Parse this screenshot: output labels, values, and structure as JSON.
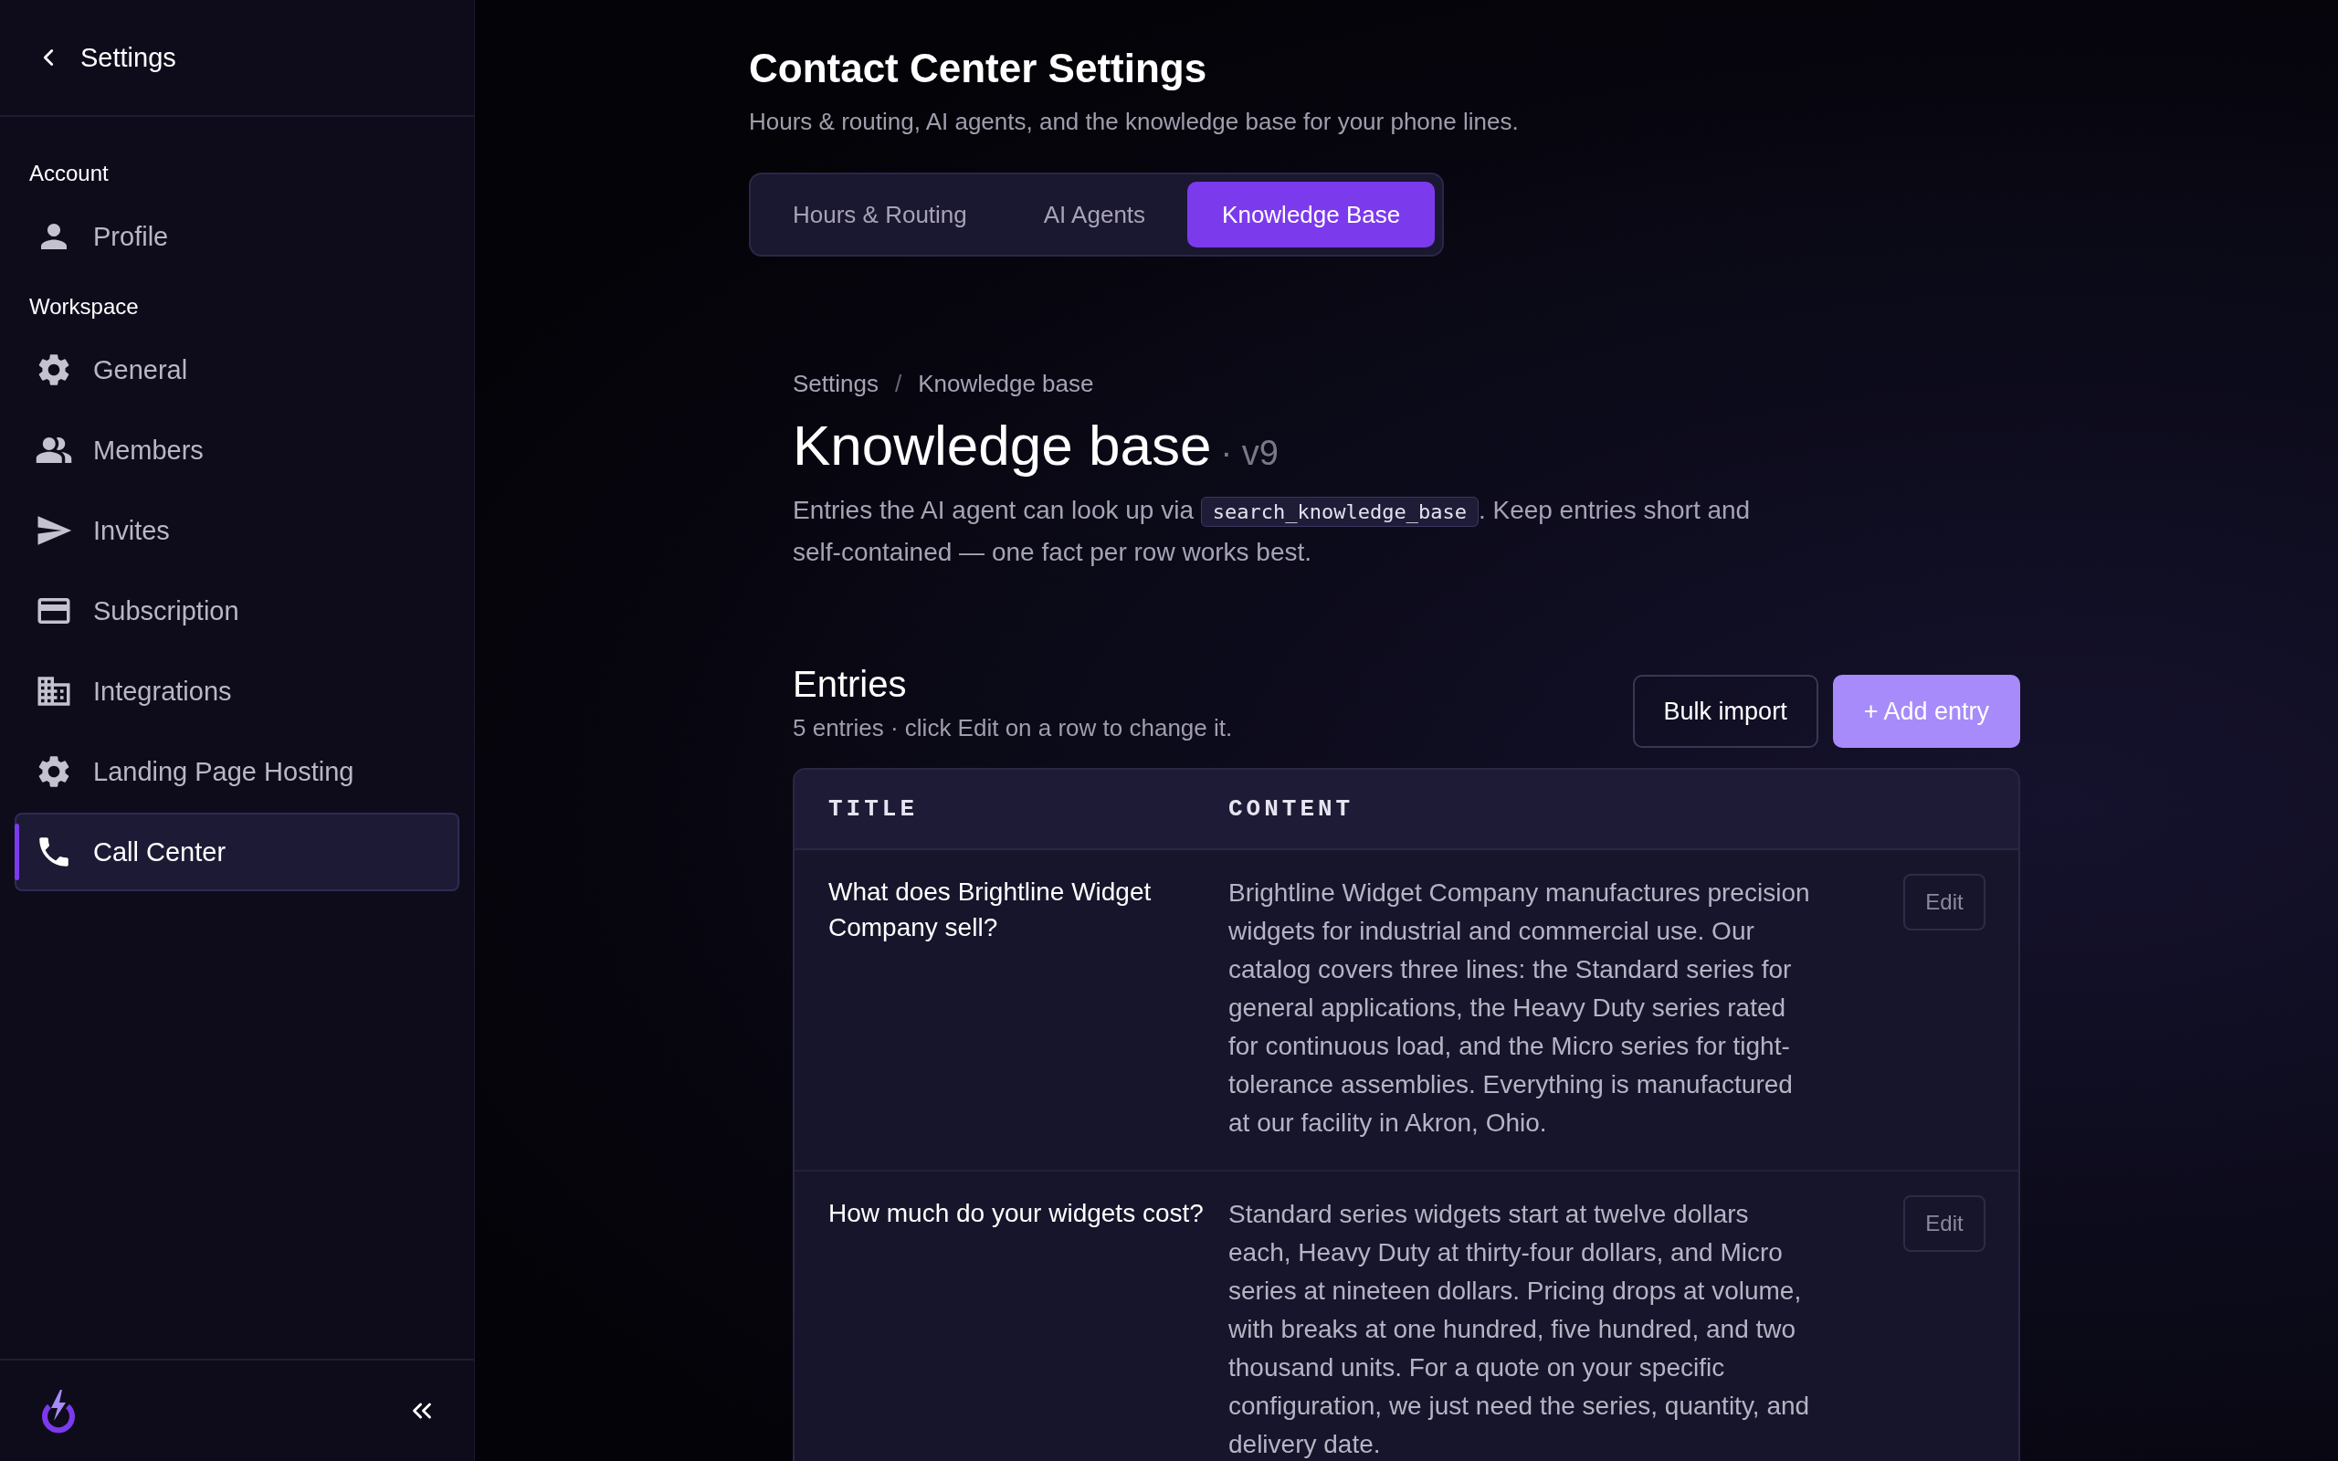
{
  "sidebar": {
    "back_label": "Settings",
    "sections": [
      {
        "label": "Account",
        "items": [
          {
            "label": "Profile",
            "kind": "person",
            "selected": false
          }
        ]
      },
      {
        "label": "Workspace",
        "items": [
          {
            "label": "General",
            "kind": "gear",
            "selected": false
          },
          {
            "label": "Members",
            "kind": "people",
            "selected": false
          },
          {
            "label": "Invites",
            "kind": "send",
            "selected": false
          },
          {
            "label": "Subscription",
            "kind": "card",
            "selected": false
          },
          {
            "label": "Integrations",
            "kind": "building",
            "selected": false
          },
          {
            "label": "Landing Page Hosting",
            "kind": "gear",
            "selected": false
          },
          {
            "label": "Call Center",
            "kind": "phone",
            "selected": true
          }
        ]
      }
    ]
  },
  "header": {
    "title": "Contact Center Settings",
    "subtitle": "Hours & routing, AI agents, and the knowledge base for your phone lines."
  },
  "tabs": [
    {
      "label": "Hours & Routing",
      "selected": false
    },
    {
      "label": "AI Agents",
      "selected": false
    },
    {
      "label": "Knowledge Base",
      "selected": true
    }
  ],
  "breadcrumb": {
    "items": [
      "Settings",
      "Knowledge base"
    ],
    "separator": "/"
  },
  "page": {
    "title": "Knowledge base",
    "version": "· v9",
    "description_before": "Entries the AI agent can look up via",
    "code": "search_knowledge_base",
    "description_after": ". Keep entries short and self-contained — one fact per row works best."
  },
  "entries": {
    "title": "Entries",
    "summary": "5 entries · click Edit on a row to change it.",
    "buttons": [
      {
        "label": "Bulk import",
        "kind": "secondary"
      },
      {
        "label": "+ Add entry",
        "kind": "primary"
      }
    ],
    "table": {
      "columns": [
        "TITLE",
        "CONTENT"
      ],
      "rows": [
        {
          "title": "What does Brightline Widget Company sell?",
          "content": "Brightline Widget Company manufactures precision widgets for industrial and commercial use. Our catalog covers three lines: the Standard series for general applications, the Heavy Duty series rated for continuous load, and the Micro series for tight-tolerance assemblies. Everything is manufactured at our facility in Akron, Ohio.",
          "action": "Edit"
        },
        {
          "title": "How much do your widgets cost?",
          "content": "Standard series widgets start at twelve dollars each, Heavy Duty at thirty-four dollars, and Micro series at nineteen dollars. Pricing drops at volume, with breaks at one hundred, five hundred, and two thousand units. For a quote on your specific configuration, we just need the series, quantity, and delivery date.",
          "action": "Edit"
        }
      ]
    }
  }
}
